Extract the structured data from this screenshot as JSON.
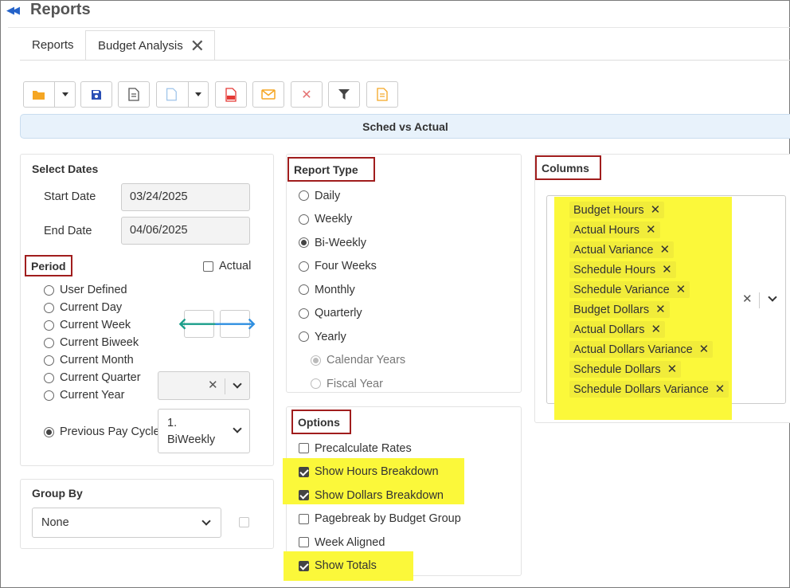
{
  "header": {
    "title": "Reports",
    "collapse_icon": "double-chevron-left-icon"
  },
  "tabs": [
    {
      "label": "Reports",
      "active": false
    },
    {
      "label": "Budget Analysis",
      "active": true,
      "closable": true
    }
  ],
  "toolbar": {
    "buttons": [
      {
        "icon": "folder-icon",
        "color": "#f5a623",
        "has_dropdown": true
      },
      {
        "icon": "save-icon",
        "color": "#2a4fb5"
      },
      {
        "icon": "document-icon",
        "color": "#555555"
      },
      {
        "icon": "new-document-icon",
        "color": "#9ec4ea",
        "has_dropdown": true
      },
      {
        "icon": "pdf-icon",
        "color": "#e53935"
      },
      {
        "icon": "email-icon",
        "color": "#f5a623"
      },
      {
        "icon": "delete-icon",
        "color": "#e57373"
      },
      {
        "icon": "filter-icon",
        "color": "#444444"
      },
      {
        "icon": "report-icon",
        "color": "#f5a623"
      }
    ]
  },
  "banner": {
    "title": "Sched vs Actual"
  },
  "dates": {
    "section_label": "Select Dates",
    "start_label": "Start Date",
    "start_value": "03/24/2025",
    "end_label": "End Date",
    "end_value": "04/06/2025"
  },
  "period": {
    "label": "Period",
    "actual_label": "Actual",
    "actual_checked": false,
    "options": [
      {
        "label": "User Defined",
        "selected": false
      },
      {
        "label": "Current Day",
        "selected": false
      },
      {
        "label": "Current Week",
        "selected": false
      },
      {
        "label": "Current Biweek",
        "selected": false
      },
      {
        "label": "Current Month",
        "selected": false
      },
      {
        "label": "Current Quarter",
        "selected": false
      },
      {
        "label": "Current Year",
        "selected": false
      }
    ],
    "previous_pay_cycle_label": "Previous Pay Cycle",
    "previous_pay_cycle_selected": true,
    "pay_cycle_value_line1": "1.",
    "pay_cycle_value_line2": "BiWeekly",
    "prev_arrow_color": "#1b9e8a",
    "next_arrow_color": "#2f8fe0"
  },
  "group_by": {
    "label": "Group By",
    "value": "None"
  },
  "report_type": {
    "label": "Report Type",
    "options": [
      {
        "label": "Daily",
        "selected": false
      },
      {
        "label": "Weekly",
        "selected": false
      },
      {
        "label": "Bi-Weekly",
        "selected": true
      },
      {
        "label": "Four Weeks",
        "selected": false
      },
      {
        "label": "Monthly",
        "selected": false
      },
      {
        "label": "Quarterly",
        "selected": false
      },
      {
        "label": "Yearly",
        "selected": false
      }
    ],
    "sub_options": [
      {
        "label": "Calendar Years",
        "selected": true
      },
      {
        "label": "Fiscal Year",
        "selected": false
      }
    ]
  },
  "options": {
    "label": "Options",
    "items": [
      {
        "label": "Precalculate Rates",
        "checked": false,
        "highlighted": false
      },
      {
        "label": "Show Hours Breakdown",
        "checked": true,
        "highlighted": true
      },
      {
        "label": "Show Dollars Breakdown",
        "checked": true,
        "highlighted": true
      },
      {
        "label": "Pagebreak by Budget Group",
        "checked": false,
        "highlighted": false
      },
      {
        "label": "Week Aligned",
        "checked": false,
        "highlighted": false
      },
      {
        "label": "Show Totals",
        "checked": true,
        "highlighted": true
      }
    ]
  },
  "columns": {
    "label": "Columns",
    "selected": [
      "Budget Hours",
      "Actual Hours",
      "Actual Variance",
      "Schedule Hours",
      "Schedule Variance",
      "Budget Dollars",
      "Actual Dollars",
      "Actual Dollars Variance",
      "Schedule Dollars",
      "Schedule Dollars Variance"
    ],
    "chip_remove_glyph": "✕",
    "clear_glyph": "✕"
  },
  "colors": {
    "highlight": "#fbf83a",
    "annotation_box": "#a01d1d",
    "banner_bg": "#e8f2fb",
    "accent_blue": "#2563c9"
  }
}
